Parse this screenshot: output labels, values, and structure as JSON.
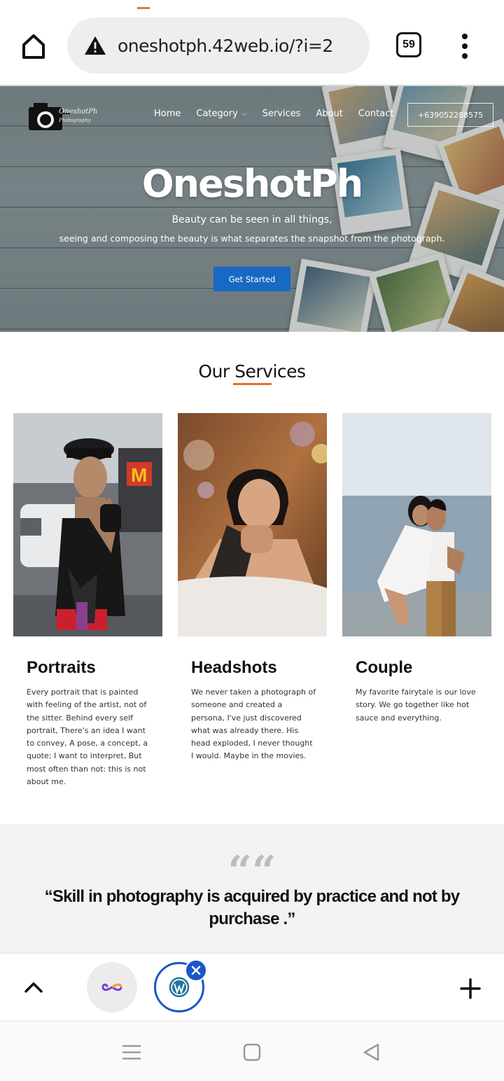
{
  "browser": {
    "url": "oneshotph.42web.io/?i=2",
    "tab_count": "59",
    "status_slice_colors": [
      "#e07a2c",
      "#2fb58a"
    ]
  },
  "site": {
    "logo_text": "OneshotPh",
    "logo_sub": "Photography",
    "nav": [
      {
        "label": "Home"
      },
      {
        "label": "Category"
      },
      {
        "label": "Services"
      },
      {
        "label": "About"
      },
      {
        "label": "Contact"
      }
    ],
    "phone": "+639052288575"
  },
  "hero": {
    "title": "OneshotPh",
    "subtitle_1": "Beauty can be seen in all things,",
    "subtitle_2": "seeing and composing the beauty is what separates the snapshot from the photograph.",
    "cta": "Get Started",
    "cta_color": "#1769c4"
  },
  "services": {
    "heading": "Our Services",
    "underline_color": "#e2702a",
    "items": [
      {
        "title": "Portraits",
        "text": "Every portrait that is painted with feeling of the artist, not of the sitter. Behind every self portrait, There's an idea I want to convey, A pose, a concept, a quote; I want to interpret, But most often than not: this is not about me."
      },
      {
        "title": "Headshots",
        "text": "We never taken a photograph of someone and created a persona, I've just discovered what was already there. His head exploded, I never thought I would. Maybe in the movies."
      },
      {
        "title": "Couple",
        "text": "My favorite fairytale is our love story. We go together like hot sauce and everything."
      }
    ]
  },
  "quote": {
    "mark": "““",
    "text": "“Skill in photography is acquired by practice and not by purchase .”"
  },
  "toolbar": {
    "accent": "#1a56c6"
  }
}
